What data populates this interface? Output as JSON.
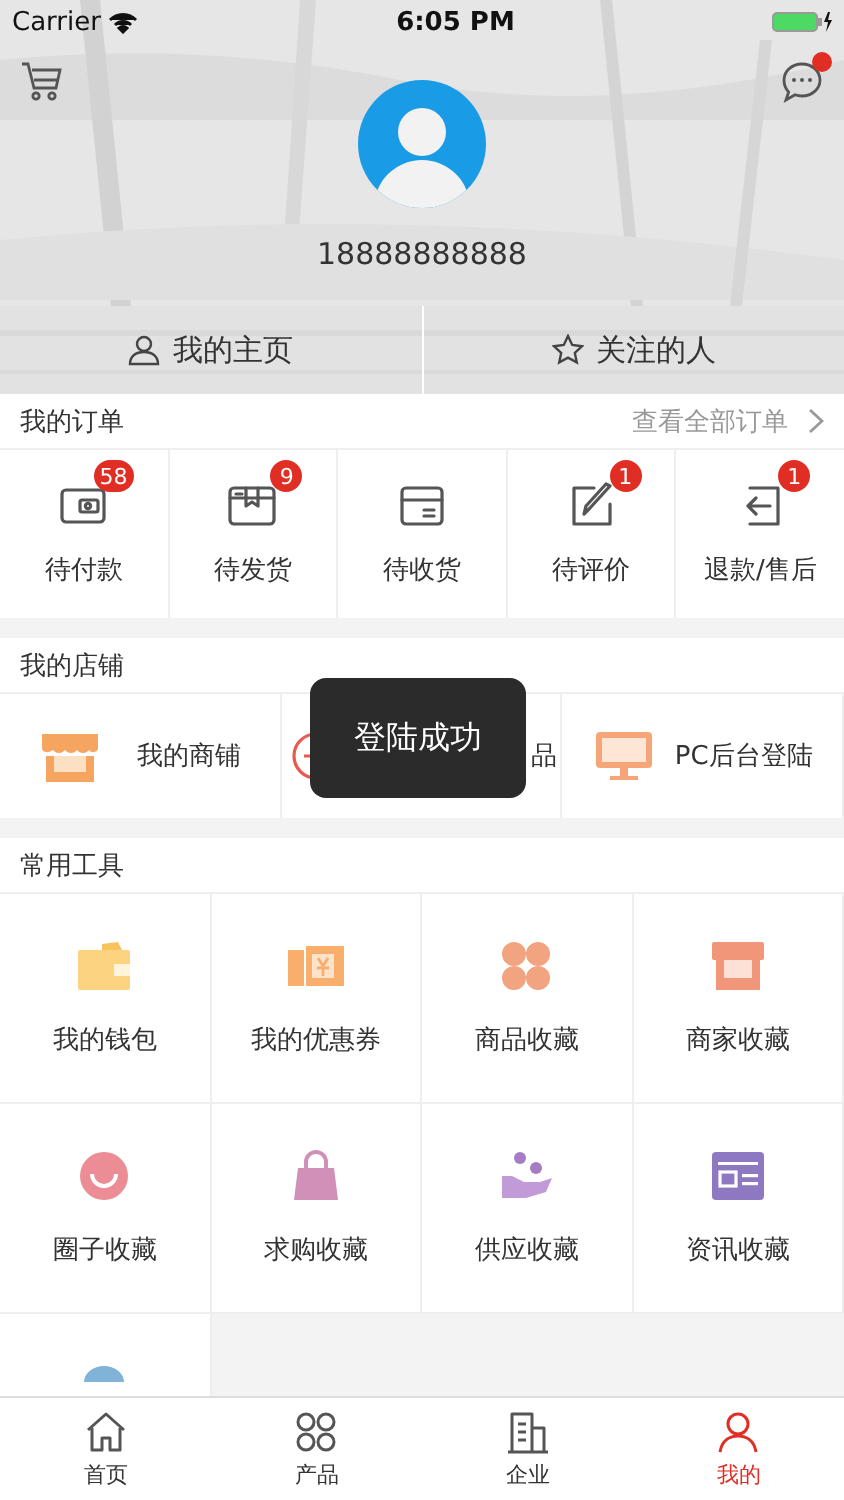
{
  "status_bar": {
    "carrier": "Carrier",
    "time": "6:05 PM"
  },
  "profile": {
    "phone": "18888888888",
    "has_message_dot": true
  },
  "profile_tabs": [
    {
      "kind": "person",
      "label": "我的主页"
    },
    {
      "kind": "star",
      "label": "关注的人"
    }
  ],
  "orders": {
    "title": "我的订单",
    "link": "查看全部订单",
    "items": [
      {
        "kind": "wallet",
        "label": "待付款",
        "badge": "58"
      },
      {
        "kind": "box",
        "label": "待发货",
        "badge": "9"
      },
      {
        "kind": "tray",
        "label": "待收货"
      },
      {
        "kind": "pen",
        "label": "待评价",
        "badge": "1"
      },
      {
        "kind": "return",
        "label": "退款/售后",
        "badge": "1"
      }
    ]
  },
  "store": {
    "title": "我的店铺",
    "items": [
      {
        "kind": "shop",
        "label": "我的商铺"
      },
      {
        "kind": "plus",
        "label": "品"
      },
      {
        "kind": "monitor",
        "label": "PC后台登陆"
      }
    ]
  },
  "toast": "登陆成功",
  "tools": {
    "title": "常用工具",
    "items": [
      {
        "kind": "wallet",
        "label": "我的钱包"
      },
      {
        "kind": "coupon",
        "label": "我的优惠券"
      },
      {
        "kind": "clover",
        "label": "商品收藏"
      },
      {
        "kind": "shop",
        "label": "商家收藏"
      },
      {
        "kind": "smile",
        "label": "圈子收藏"
      },
      {
        "kind": "bag",
        "label": "求购收藏"
      },
      {
        "kind": "hand",
        "label": "供应收藏"
      },
      {
        "kind": "news",
        "label": "资讯收藏"
      },
      {
        "kind": "dot"
      }
    ]
  },
  "tab_bar": [
    {
      "kind": "home",
      "label": "首页",
      "selected": false
    },
    {
      "kind": "grid",
      "label": "产品",
      "selected": false
    },
    {
      "kind": "building",
      "label": "企业",
      "selected": false
    },
    {
      "kind": "user",
      "label": "我的",
      "selected": true
    }
  ]
}
